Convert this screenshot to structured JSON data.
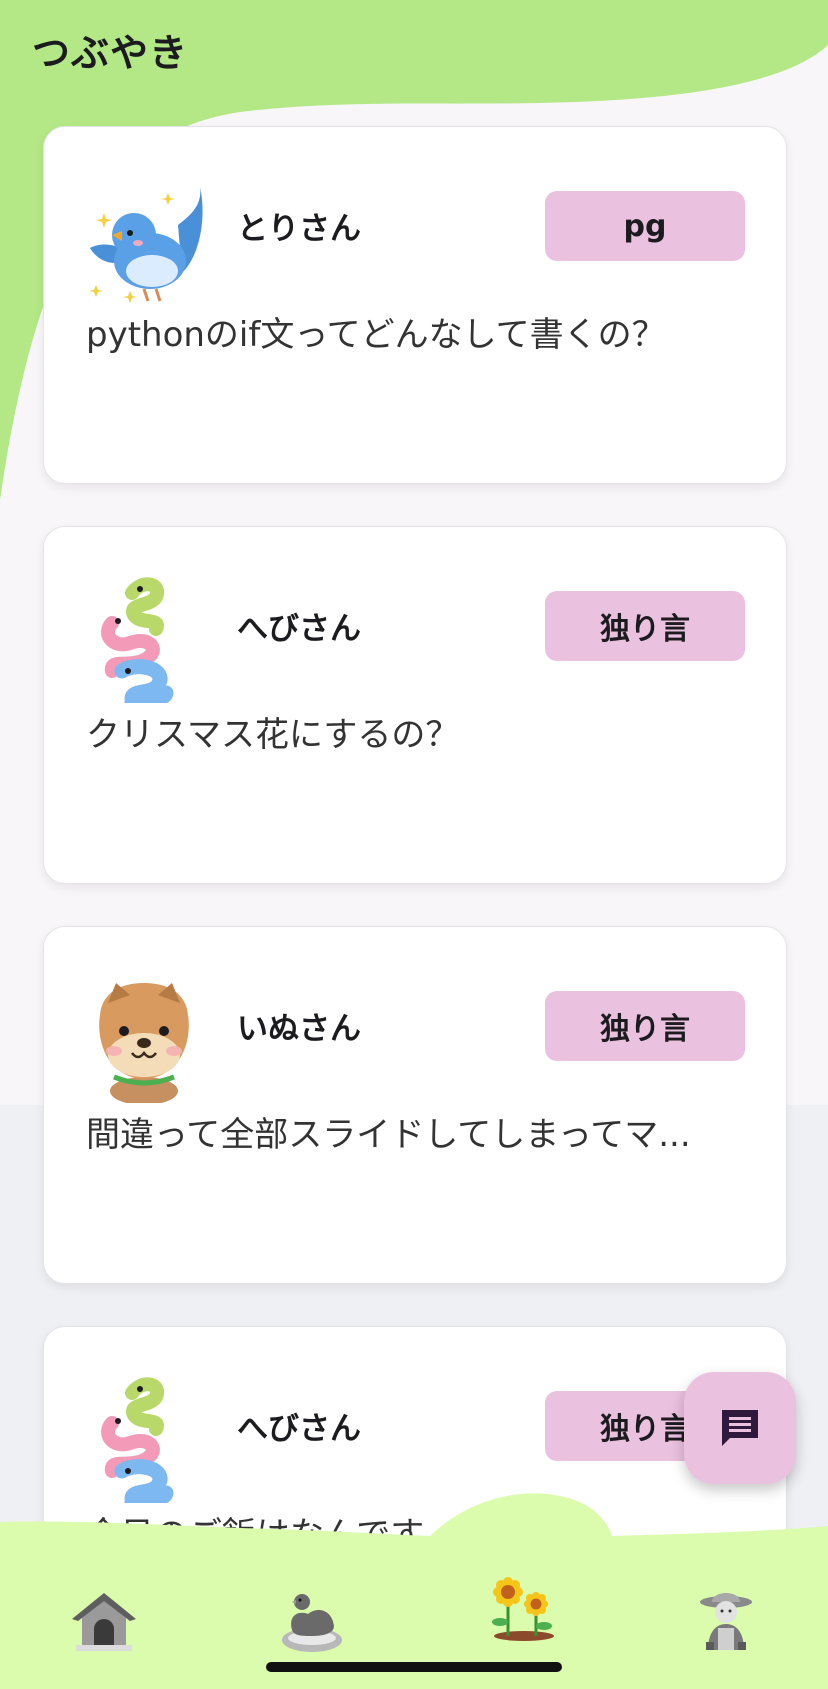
{
  "header": {
    "title": "つぶやき"
  },
  "posts": [
    {
      "username": "とりさん",
      "tag": "pg",
      "text": "pythonのif文ってどんなして書くの？",
      "avatar_icon": "bird-icon"
    },
    {
      "username": "へびさん",
      "tag": "独り言",
      "text": "クリスマス花にするの？",
      "avatar_icon": "snake-icon"
    },
    {
      "username": "いぬさん",
      "tag": "独り言",
      "text": "間違って全部スライドしてしまってマ...",
      "avatar_icon": "dog-icon"
    },
    {
      "username": "へびさん",
      "tag": "独り言",
      "text": "今日のご飯はなんです",
      "avatar_icon": "snake-icon"
    }
  ],
  "fab": {
    "icon": "chat-icon"
  },
  "bottom_nav": [
    {
      "icon": "doghouse-icon"
    },
    {
      "icon": "hen-nest-icon"
    },
    {
      "icon": "sunflower-icon",
      "selected": true
    },
    {
      "icon": "farmer-icon"
    }
  ],
  "colors": {
    "header_green": "#b4e886",
    "nav_green": "#dbfbad",
    "tag_pink": "#ebc1e0",
    "page_bg": "#f8f6f9"
  }
}
